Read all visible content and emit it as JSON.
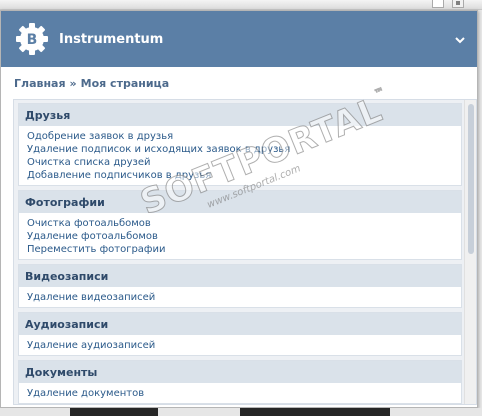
{
  "app": {
    "title": "Instrumentum"
  },
  "breadcrumb": {
    "home": "Главная",
    "separator": "»",
    "current": "Моя страница"
  },
  "sections": [
    {
      "title": "Друзья",
      "items": [
        "Одобрение заявок в друзья",
        "Удаление подписок и исходящих заявок в друзья",
        "Очистка списка друзей",
        "Добавление подписчиков в друзья"
      ]
    },
    {
      "title": "Фотографии",
      "items": [
        "Очистка фотоальбомов",
        "Удаление фотоальбомов",
        "Переместить фотографии"
      ]
    },
    {
      "title": "Видеозаписи",
      "items": [
        "Удаление видеозаписей"
      ]
    },
    {
      "title": "Аудиозаписи",
      "items": [
        "Удаление аудиозаписей"
      ]
    },
    {
      "title": "Документы",
      "items": [
        "Удаление документов"
      ]
    }
  ],
  "watermark": {
    "main": "SOFTPORTAL",
    "tm": "™",
    "sub": "www.softportal.com"
  },
  "icons": {
    "logo": "vk-gear-logo-icon",
    "expand": "chevron-down-icon"
  },
  "colors": {
    "header": "#5b7fa6",
    "section_header": "#dae2ea",
    "link": "#2b5a8a"
  }
}
